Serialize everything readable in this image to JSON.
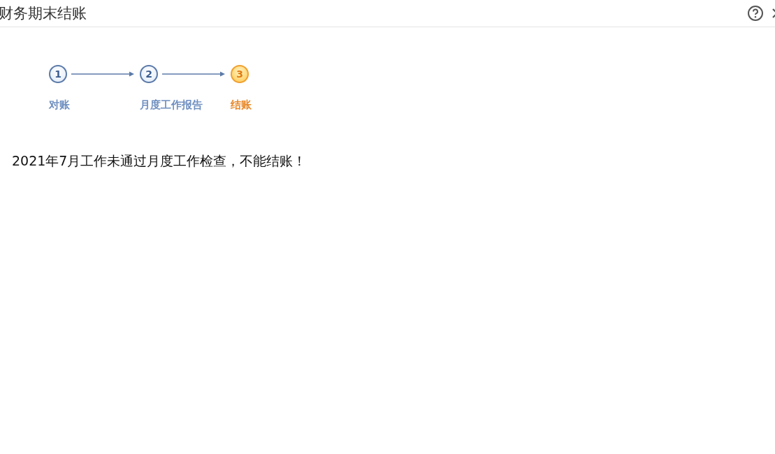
{
  "window": {
    "title": "财务期末结账"
  },
  "steps": [
    {
      "number": "1",
      "label": "对账",
      "selected": false
    },
    {
      "number": "2",
      "label": "月度工作报告",
      "selected": false
    },
    {
      "number": "3",
      "label": "结账",
      "selected": true
    }
  ],
  "message": "2021年7月工作未通过月度工作检查，不能结账！"
}
